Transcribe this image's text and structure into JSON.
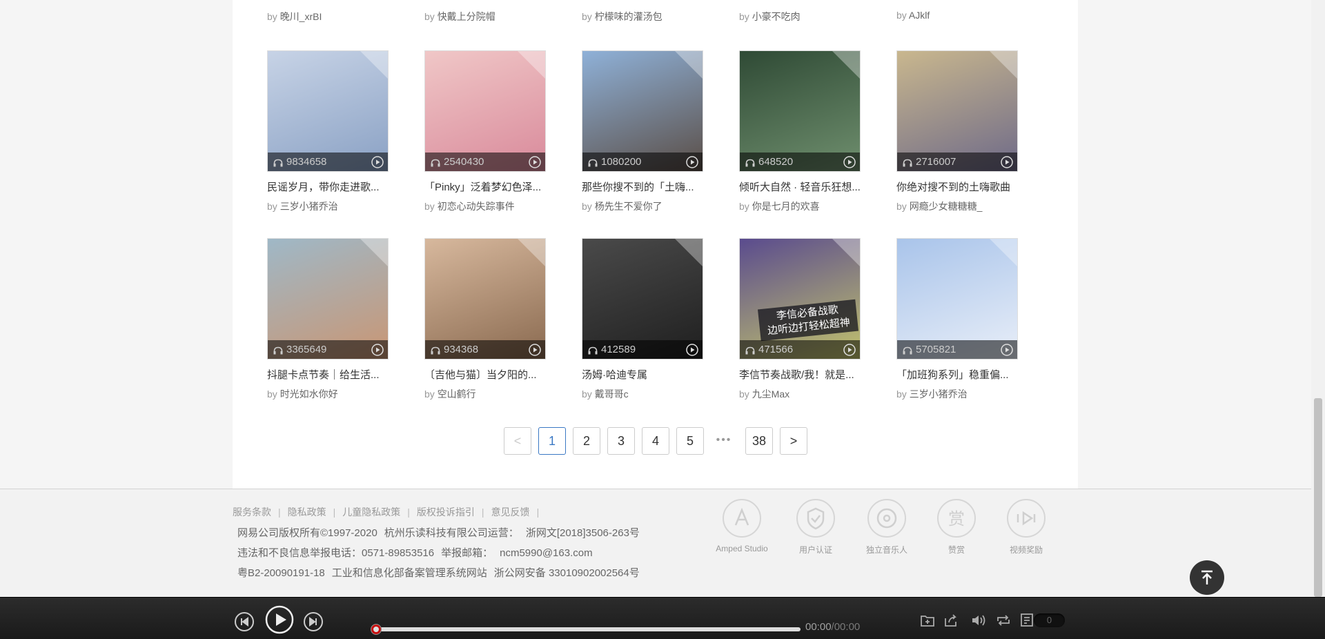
{
  "top_authors": [
    {
      "by": "by",
      "name": "晚川_xrBI"
    },
    {
      "by": "by",
      "name": "快戴上分院帽"
    },
    {
      "by": "by",
      "name": "柠檬味的灌汤包"
    },
    {
      "by": "by",
      "name": "小豪不吃肉"
    },
    {
      "by": "by",
      "name": "AJklf"
    }
  ],
  "playlists": [
    {
      "count": "9834658",
      "title": "民谣岁月，带你走进歌...",
      "by": "by",
      "author": "三岁小猪乔治",
      "colors": [
        "#c7d3e6",
        "#8aa1c4"
      ]
    },
    {
      "count": "2540430",
      "title": "「Pinky」泛着梦幻色泽...",
      "by": "by",
      "author": "初恋心动失踪事件",
      "colors": [
        "#f0c7c7",
        "#d98a9b"
      ]
    },
    {
      "count": "1080200",
      "title": "那些你搜不到的「土嗨...",
      "by": "by",
      "author": "杨先生不爱你了",
      "colors": [
        "#8fb1d8",
        "#5a4e47"
      ]
    },
    {
      "count": "648520",
      "title": "倾听大自然 · 轻音乐狂想...",
      "by": "by",
      "author": "你是七月的欢喜",
      "colors": [
        "#2f4a35",
        "#6f8f6e"
      ]
    },
    {
      "count": "2716007",
      "title": "你绝对搜不到的土嗨歌曲",
      "by": "by",
      "author": "网瘾少女糖糖糖_",
      "colors": [
        "#c9b78e",
        "#6e6a88"
      ]
    },
    {
      "count": "3365649",
      "title": "抖腿卡点节奏｜给生活...",
      "by": "by",
      "author": "时光如水你好",
      "colors": [
        "#9fb8c7",
        "#c99674"
      ]
    },
    {
      "count": "934368",
      "title": "〔吉他与猫〕当夕阳的...",
      "by": "by",
      "author": "空山鹤行",
      "colors": [
        "#d7b89d",
        "#8a6a50"
      ]
    },
    {
      "count": "412589",
      "title": "汤姆·哈迪专属",
      "by": "by",
      "author": "戴哥哥c",
      "colors": [
        "#4a4a4a",
        "#1f1f1f"
      ]
    },
    {
      "count": "471566",
      "title": "李信节奏战歌/我！就是...",
      "by": "by",
      "author": "九尘Max",
      "colors": [
        "#5a4b8e",
        "#c2c36d"
      ],
      "overlay": [
        "李信必备战歌",
        "边听边打轻松超神"
      ]
    },
    {
      "count": "5705821",
      "title": "「加班狗系列」稳重偏...",
      "by": "by",
      "author": "三岁小猪乔治",
      "colors": [
        "#a9c4ea",
        "#e8eef8"
      ]
    }
  ],
  "pagination": {
    "prev": "<",
    "pages": [
      "1",
      "2",
      "3",
      "4",
      "5"
    ],
    "ellipsis": "•••",
    "last": "38",
    "next": ">",
    "current": "1"
  },
  "footer": {
    "links": [
      "服务条款",
      "隐私政策",
      "儿童隐私政策",
      "版权投诉指引",
      "意见反馈"
    ],
    "separator": "|",
    "line1": [
      "网易公司版权所有©1997-2020",
      "杭州乐读科技有限公司运营：",
      "浙网文[2018]3506-263号"
    ],
    "line2": [
      "违法和不良信息举报电话：0571-89853516",
      "举报邮箱：",
      "ncm5990@163.com"
    ],
    "line3": [
      "粤B2-20090191-18",
      "工业和信息化部备案管理系统网站",
      "浙公网安备 33010902002564号"
    ],
    "badges": [
      {
        "label": "Amped Studio",
        "icon": "amped-studio-icon"
      },
      {
        "label": "用户认证",
        "icon": "user-verify-icon"
      },
      {
        "label": "独立音乐人",
        "icon": "indie-musician-icon"
      },
      {
        "label": "赞赏",
        "icon": "appreciate-icon"
      },
      {
        "label": "视频奖励",
        "icon": "video-reward-icon"
      }
    ]
  },
  "player": {
    "time_current": "00:00",
    "time_total": "/00:00",
    "playlist_count": "0",
    "progress": 0
  }
}
